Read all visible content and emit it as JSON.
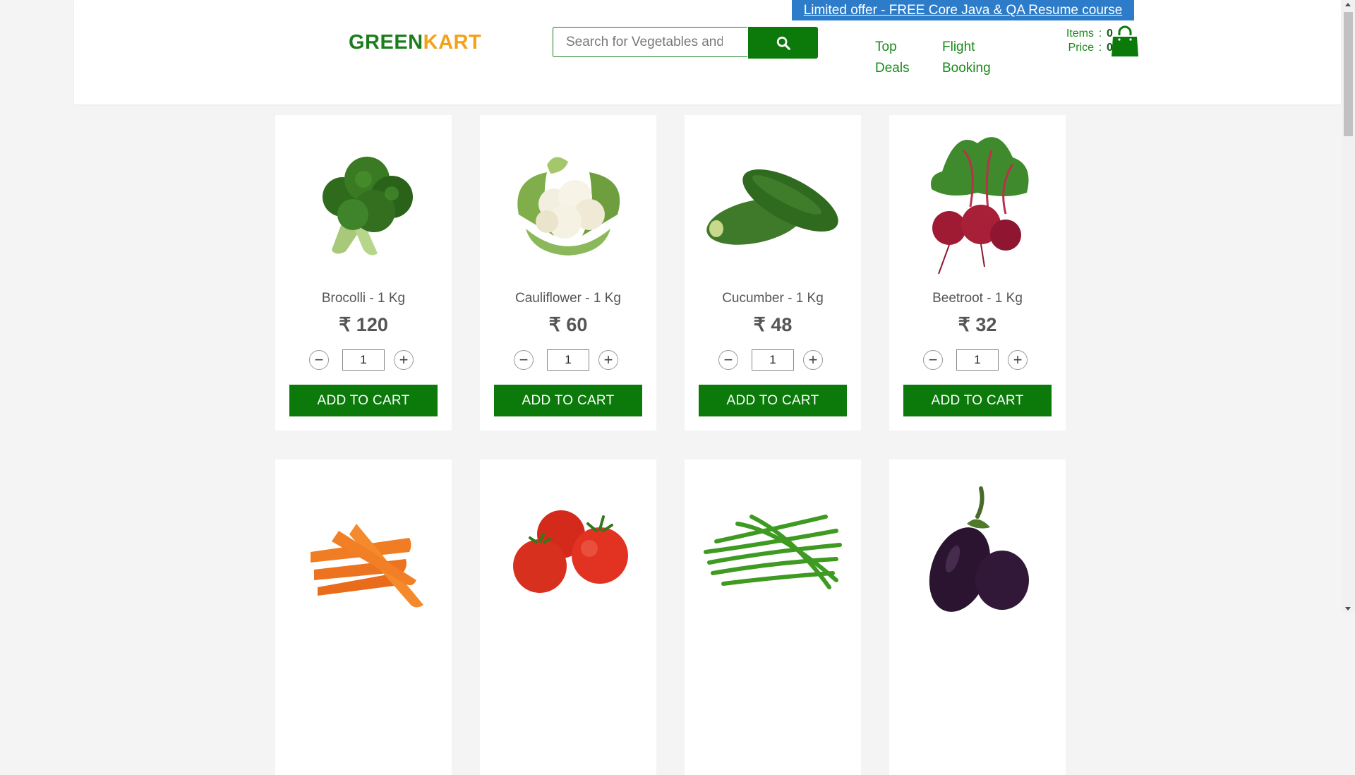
{
  "header": {
    "offer_text": "Limited offer - FREE Core Java & QA Resume course",
    "brand": {
      "part1": "GREEN",
      "part2": "KART"
    },
    "search_placeholder": "Search for Vegetables and Fruits",
    "nav": [
      {
        "line1": "Top",
        "line2": "Deals"
      },
      {
        "line1": "Flight",
        "line2": "Booking"
      }
    ],
    "cart": {
      "items_label": "Items",
      "items_value": "0",
      "price_label": "Price",
      "price_value": "0",
      "separator": ":"
    }
  },
  "currency": "₹",
  "add_label": "ADD TO CART",
  "products": [
    {
      "name": "Brocolli - 1 Kg",
      "price": "₹ 120",
      "qty": "1",
      "image": "broccoli"
    },
    {
      "name": "Cauliflower - 1 Kg",
      "price": "₹ 60",
      "qty": "1",
      "image": "cauliflower"
    },
    {
      "name": "Cucumber - 1 Kg",
      "price": "₹ 48",
      "qty": "1",
      "image": "cucumber"
    },
    {
      "name": "Beetroot - 1 Kg",
      "price": "₹ 32",
      "qty": "1",
      "image": "beetroot"
    },
    {
      "image": "carrot"
    },
    {
      "image": "tomato"
    },
    {
      "image": "beans"
    },
    {
      "image": "brinjal"
    }
  ],
  "colors": {
    "brand_green": "#0b7a0b",
    "brand_orange": "#f4a11a",
    "offer_blue": "#2d7cc9"
  },
  "icons": {
    "search": "search-icon",
    "cart": "shopping-bag-icon",
    "decrement": "minus-icon",
    "increment": "plus-icon"
  }
}
